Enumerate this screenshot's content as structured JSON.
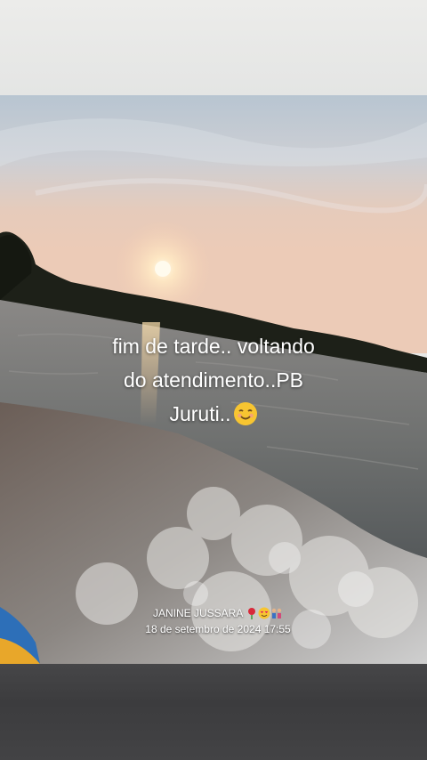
{
  "caption": {
    "line1": "fim de tarde.. voltando",
    "line2": "do atendimento..PB",
    "line3": "Juruti..",
    "emoji": "smiling-face-emoji"
  },
  "signature": {
    "name": "JANINE JUSSARA",
    "emojis": [
      "rose-emoji",
      "heart-eyes-face-emoji",
      "family-emoji"
    ],
    "date": "18 de setembro de 2024 17:55"
  },
  "colors": {
    "sky_top": "#b9c6d2",
    "sky_horizon": "#e9c8b4",
    "sun": "#fff6dc",
    "treeline": "#1c1f17",
    "water": "#6f7170",
    "spray": "#d9d7d3"
  }
}
